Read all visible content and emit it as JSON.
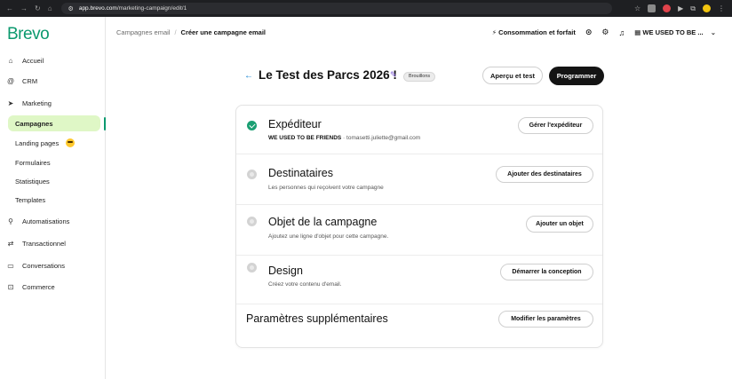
{
  "browser": {
    "url_host": "app.brevo.com",
    "url_path": "/marketing-campaign/edit/1"
  },
  "logo": "Brevo",
  "breadcrumb": {
    "parent": "Campagnes email",
    "current": "Créer une campagne email"
  },
  "header": {
    "plan_label": "Consommation et forfait",
    "account_label": "WE USED TO BE ..."
  },
  "sidebar": {
    "items": [
      {
        "label": "Accueil",
        "icon": "home-icon"
      },
      {
        "label": "CRM",
        "icon": "at-sign-icon"
      },
      {
        "label": "Marketing",
        "icon": "send-icon"
      },
      {
        "label": "Automatisations",
        "icon": "workflow-icon"
      },
      {
        "label": "Transactionnel",
        "icon": "exchange-icon"
      },
      {
        "label": "Conversations",
        "icon": "chat-icon"
      },
      {
        "label": "Commerce",
        "icon": "bag-icon"
      }
    ],
    "marketing_sub": [
      {
        "label": "Campagnes",
        "active": true
      },
      {
        "label": "Landing pages",
        "active": false
      },
      {
        "label": "Formulaires",
        "active": false
      },
      {
        "label": "Statistiques",
        "active": false
      },
      {
        "label": "Templates",
        "active": false
      }
    ]
  },
  "campaign": {
    "title": "Le Test des Parcs 2026 !",
    "status_badge": "Brouillons",
    "preview_button": "Aperçu et test",
    "schedule_button": "Programmer"
  },
  "steps": [
    {
      "title": "Expéditeur",
      "sender_name": "WE USED TO BE FRIENDS",
      "separator": "·",
      "sender_email": "tomasetti.juliette@gmail.com",
      "button": "Gérer l'expéditeur",
      "done": true
    },
    {
      "title": "Destinataires",
      "subtitle": "Les personnes qui reçoivent votre campagne",
      "button": "Ajouter des destinataires",
      "done": false
    },
    {
      "title": "Objet de la campagne",
      "subtitle": "Ajoutez une ligne d'objet pour cette campagne.",
      "button": "Ajouter un objet",
      "done": false
    },
    {
      "title": "Design",
      "subtitle": "Créez votre contenu d'email.",
      "button": "Démarrer la conception",
      "done": false
    },
    {
      "title": "Paramètres supplémentaires",
      "button": "Modifier les paramètres"
    }
  ],
  "colors": {
    "brand": "#0b996e",
    "active_bg": "#dff7c6",
    "primary_button": "#141414",
    "done_status": "#1a9f72"
  }
}
